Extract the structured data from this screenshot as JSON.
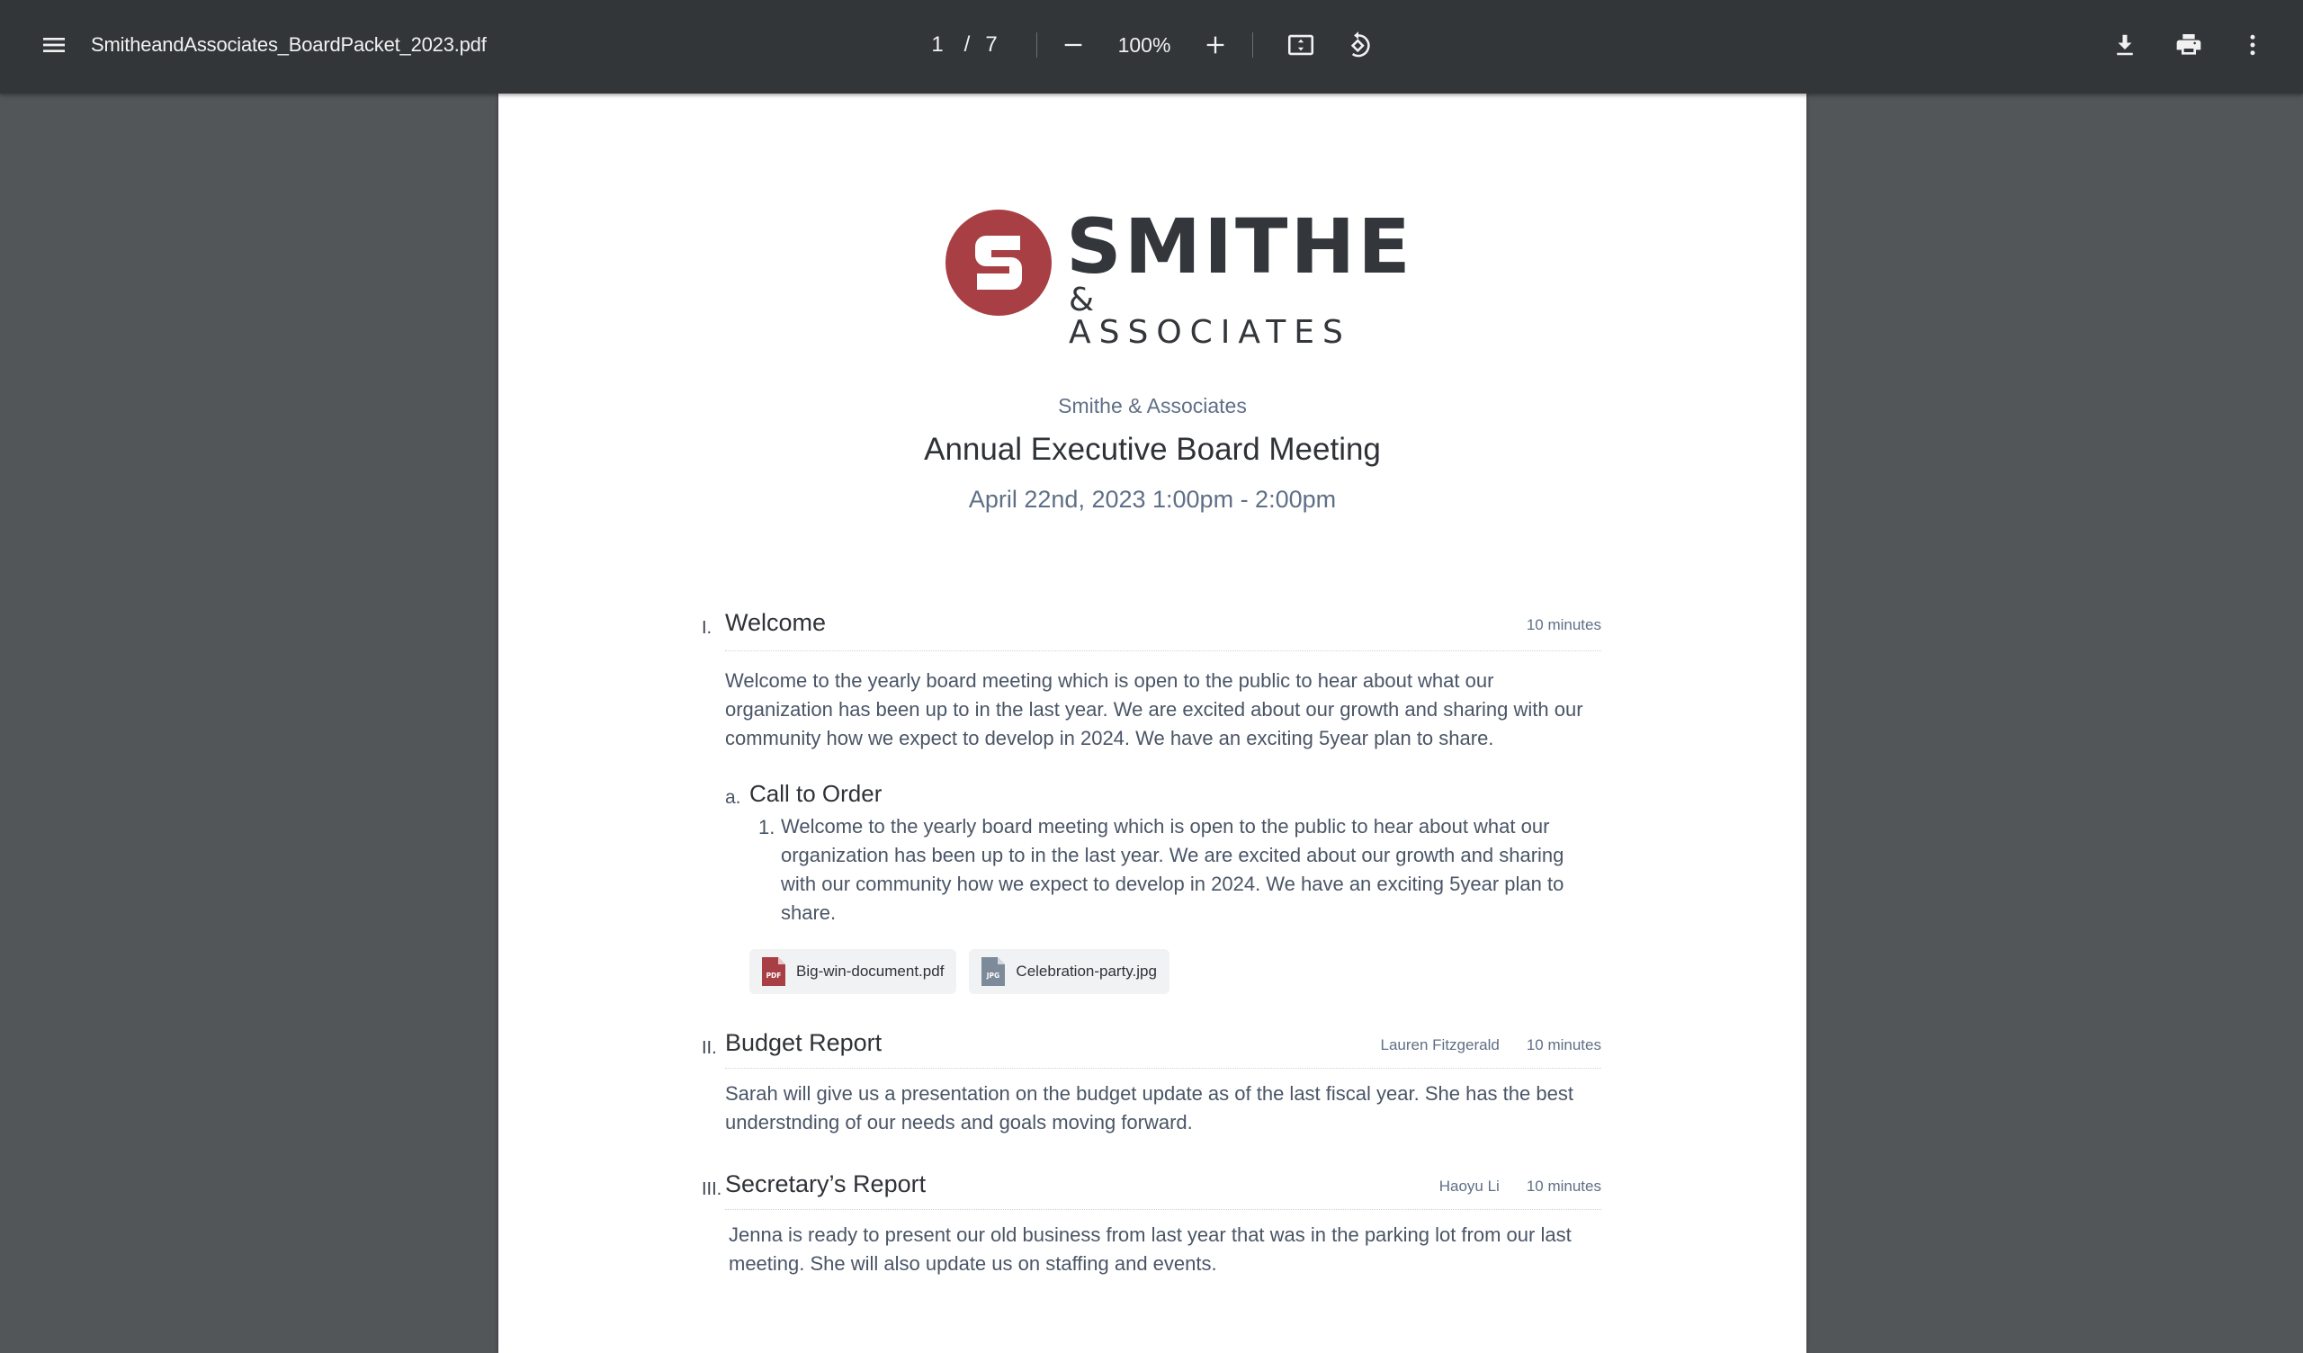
{
  "toolbar": {
    "file_name": "SmitheandAssociates_BoardPacket_2023.pdf",
    "current_page": "1",
    "page_separator": "/",
    "total_pages": "7",
    "zoom_level": "100%",
    "icons": {
      "menu": "menu-icon",
      "zoom_out": "minus-icon",
      "zoom_in": "plus-icon",
      "fit": "fit-to-page-icon",
      "rotate": "rotate-counterclockwise-icon",
      "download": "download-icon",
      "print": "print-icon",
      "more": "more-vertical-icon"
    }
  },
  "document": {
    "logo": {
      "mark_letter": "S",
      "wordmark": "SMITHE",
      "subline": "& ASSOCIATES",
      "brand_color": "#a83f44",
      "text_color": "#33363b"
    },
    "org_name": "Smithe & Associates",
    "meeting_title": "Annual Executive Board Meeting",
    "meeting_time": "April 22nd, 2023  1:00pm - 2:00pm",
    "sections": [
      {
        "number": "I.",
        "title": "Welcome",
        "presenter": "",
        "duration": "10 minutes",
        "body": "Welcome to the yearly board meeting which is open to the public to hear about what our organization has been up to in the last year. We are excited about our growth and sharing with our community how we expect to develop in 2024. We have an exciting 5year plan to share.",
        "subsections": [
          {
            "letter": "a.",
            "title": "Call to Order",
            "items": [
              {
                "number": "1.",
                "text": "Welcome to the yearly board meeting which is open to the public to hear about what our organization has been up to in the last year. We are excited about our growth and sharing with our community how we expect to develop in 2024. We have an exciting 5year plan to share."
              }
            ],
            "attachments": [
              {
                "name": "Big-win-document.pdf",
                "type": "PDF",
                "color": "#a83f44"
              },
              {
                "name": "Celebration-party.jpg",
                "type": "JPG",
                "color": "#7d8a99"
              }
            ]
          }
        ]
      },
      {
        "number": "II.",
        "title": "Budget Report",
        "presenter": "Lauren Fitzgerald",
        "duration": "10 minutes",
        "body": "Sarah will give us a presentation on the budget update as of the last fiscal year. She has the best understnding of our needs and goals moving forward."
      },
      {
        "number": "III.",
        "title": "Secretary’s Report",
        "presenter": "Haoyu Li",
        "duration": "10 minutes",
        "body": "Jenna is ready to present our old business from last year that was in the parking lot from our last meeting. She will also update us on staffing and events."
      }
    ]
  }
}
